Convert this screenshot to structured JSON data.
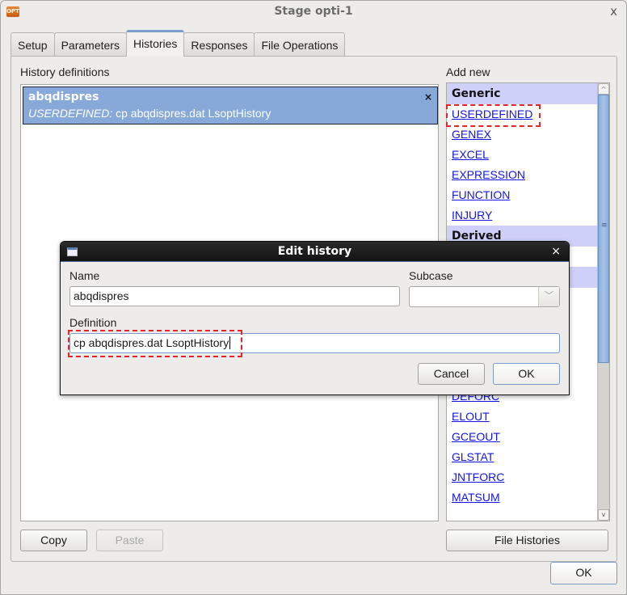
{
  "window": {
    "title": "Stage opti-1",
    "app_icon_text": "OPT",
    "close_glyph": "x"
  },
  "tabs": [
    {
      "label": "Setup",
      "active": false
    },
    {
      "label": "Parameters",
      "active": false
    },
    {
      "label": "Histories",
      "active": true
    },
    {
      "label": "Responses",
      "active": false
    },
    {
      "label": "File Operations",
      "active": false
    }
  ],
  "histories": {
    "label": "History definitions",
    "items": [
      {
        "name": "abqdispres",
        "type": "USERDEFINED:",
        "definition": "cp abqdispres.dat LsoptHistory",
        "remove_glyph": "×"
      }
    ]
  },
  "add_new": {
    "label": "Add new",
    "categories": [
      {
        "title": "Generic",
        "items": [
          "USERDEFINED",
          "GENEX",
          "EXCEL",
          "EXPRESSION",
          "FUNCTION",
          "INJURY"
        ]
      },
      {
        "title": "Derived",
        "items": [
          ""
        ]
      },
      {
        "title": "",
        "items": []
      }
    ],
    "visible_lower_items": [
      "DEFORC",
      "ELOUT",
      "GCEOUT",
      "GLSTAT",
      "JNTFORC",
      "MATSUM"
    ],
    "scroll_grip": "≡",
    "scroll_up": "^",
    "scroll_down": "v"
  },
  "buttons": {
    "copy": "Copy",
    "paste": "Paste",
    "file_histories": "File Histories",
    "ok": "OK"
  },
  "dialog": {
    "title": "Edit history",
    "close_glyph": "×",
    "name_label": "Name",
    "name_value": "abqdispres",
    "subcase_label": "Subcase",
    "subcase_value": "",
    "subcase_arrow": "﹀",
    "definition_label": "Definition",
    "definition_value": "cp abqdispres.dat LsoptHistory",
    "cancel": "Cancel",
    "ok": "OK"
  },
  "highlight_color": "#e3252a"
}
